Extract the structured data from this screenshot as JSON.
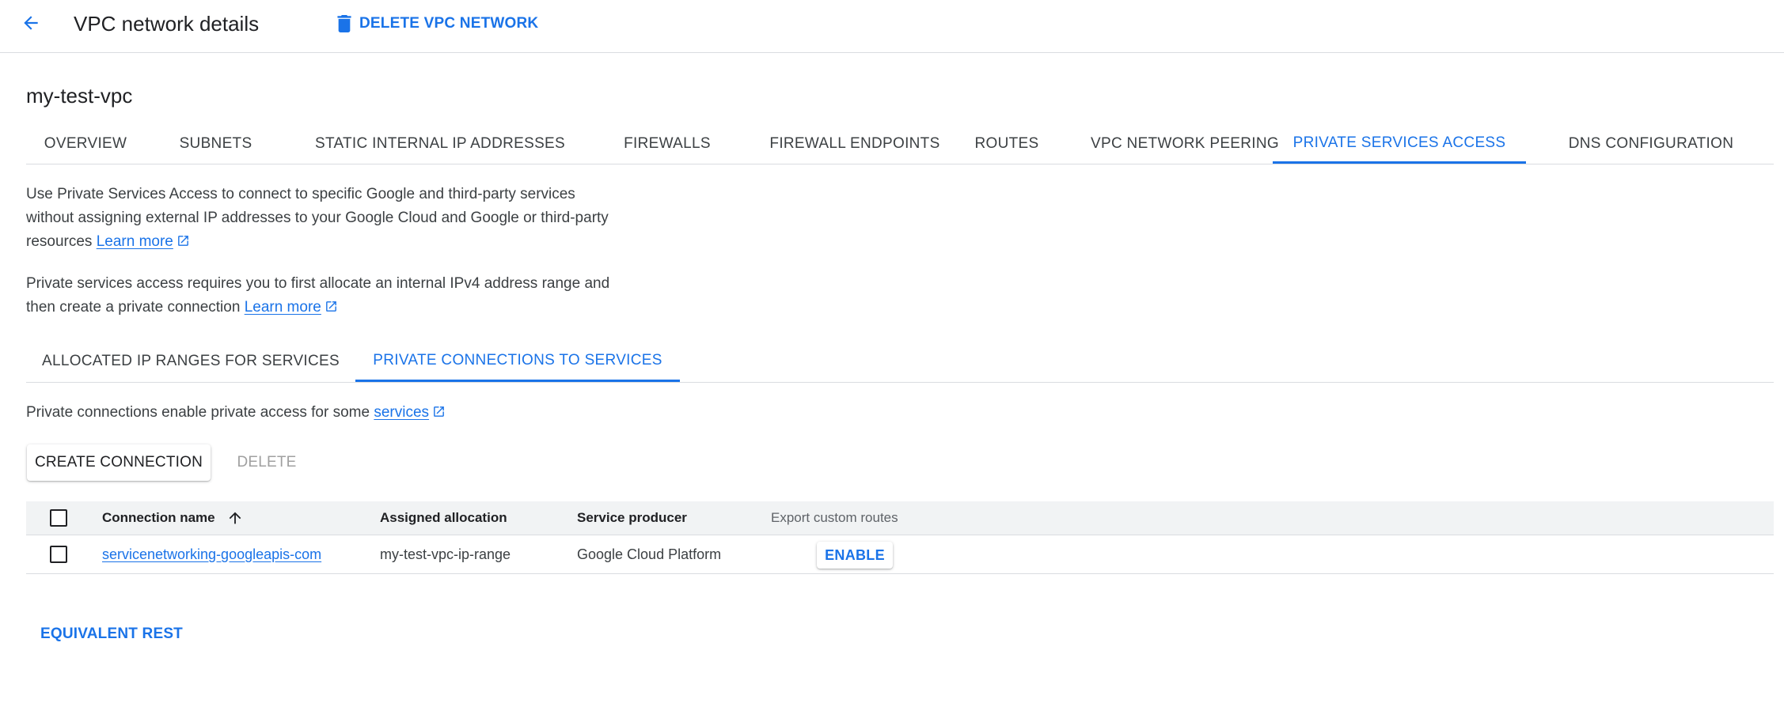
{
  "header": {
    "back_icon": "arrow-back-icon",
    "title": "VPC network details",
    "delete_icon": "trash-icon",
    "delete_label": "DELETE VPC NETWORK"
  },
  "network_name": "my-test-vpc",
  "tabs": [
    {
      "label": "OVERVIEW"
    },
    {
      "label": "SUBNETS"
    },
    {
      "label": "STATIC INTERNAL IP ADDRESSES"
    },
    {
      "label": "FIREWALLS"
    },
    {
      "label": "FIREWALL ENDPOINTS"
    },
    {
      "label": "ROUTES"
    },
    {
      "label": "VPC NETWORK PEERING"
    },
    {
      "label": "PRIVATE SERVICES ACCESS",
      "active": true
    },
    {
      "label": "DNS CONFIGURATION"
    }
  ],
  "intro": {
    "text_line1": "Use Private Services Access to connect to specific Google and third-party services",
    "text_line2": "without assigning external IP addresses to your Google Cloud and Google or third-party",
    "text_line3": "resources",
    "learn_more": "Learn more"
  },
  "requirement": {
    "text_line1": "Private services access requires you to first allocate an internal IPv4 address range and",
    "text_line2": "then create a private connection",
    "learn_more": "Learn more"
  },
  "sub_tabs": [
    {
      "label": "ALLOCATED IP RANGES FOR SERVICES"
    },
    {
      "label": "PRIVATE CONNECTIONS TO SERVICES",
      "active": true
    }
  ],
  "connections_note": {
    "text": "Private connections enable private access for some",
    "link": "services"
  },
  "actions": {
    "create_label": "CREATE CONNECTION",
    "delete_label": "DELETE"
  },
  "table": {
    "columns": [
      "Connection name",
      "Assigned allocation",
      "Service producer",
      "Export custom routes"
    ],
    "sort_icon": "arrow-up-icon",
    "rows": [
      {
        "connection_name": "servicenetworking-googleapis-com",
        "assigned_allocation": "my-test-vpc-ip-range",
        "service_producer": "Google Cloud Platform",
        "export_action": "ENABLE"
      }
    ]
  },
  "footer": {
    "equivalent_rest": "EQUIVALENT REST"
  },
  "colors": {
    "accent": "#1a73e8",
    "text": "#202124",
    "muted": "#5f6368",
    "divider": "#dadce0",
    "table_header_bg": "#f1f3f4"
  }
}
